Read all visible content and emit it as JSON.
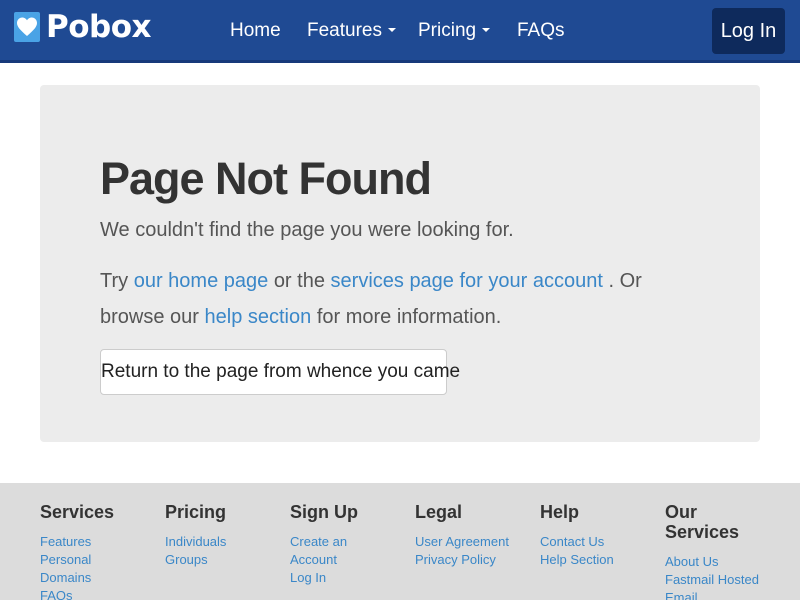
{
  "nav": {
    "brand": "Pobox",
    "items": [
      {
        "label": "Home",
        "dropdown": false
      },
      {
        "label": "Features",
        "dropdown": true
      },
      {
        "label": "Pricing",
        "dropdown": true
      },
      {
        "label": "FAQs",
        "dropdown": false
      }
    ],
    "login_label": "Log In"
  },
  "main": {
    "title": "Page Not Found",
    "lead": "We couldn't find the page you were looking for.",
    "p_try": "Try",
    "link_home": "our home page",
    "p_or_the": "or the",
    "link_services": "services page for your account",
    "p_or_browse": ". Or browse our",
    "link_help": "help section",
    "p_more": "for more information.",
    "return_button": "Return to the page from whence you came"
  },
  "footer": {
    "columns": [
      {
        "title": "Services",
        "links": [
          "Features",
          "Personal",
          "Domains",
          "FAQs"
        ]
      },
      {
        "title": "Pricing",
        "links": [
          "Individuals",
          "Groups"
        ]
      },
      {
        "title": "Sign Up",
        "links": [
          "Create an",
          "Account",
          "Log In"
        ]
      },
      {
        "title": "Legal",
        "links": [
          "User Agreement",
          "Privacy Policy"
        ]
      },
      {
        "title": "Help",
        "links": [
          "Contact Us",
          "Help Section"
        ]
      },
      {
        "title": "Our Services",
        "links": [
          "About Us",
          "Fastmail Hosted",
          "Email"
        ]
      }
    ]
  },
  "icons": {
    "brand": "heart-envelope-icon",
    "caret": "caret-down-icon"
  },
  "colors": {
    "navbar": "#1f4a93",
    "login_button": "#0e2a5c",
    "link": "#3a87c8",
    "panel": "#ececec",
    "footer": "#dcdcdc"
  }
}
